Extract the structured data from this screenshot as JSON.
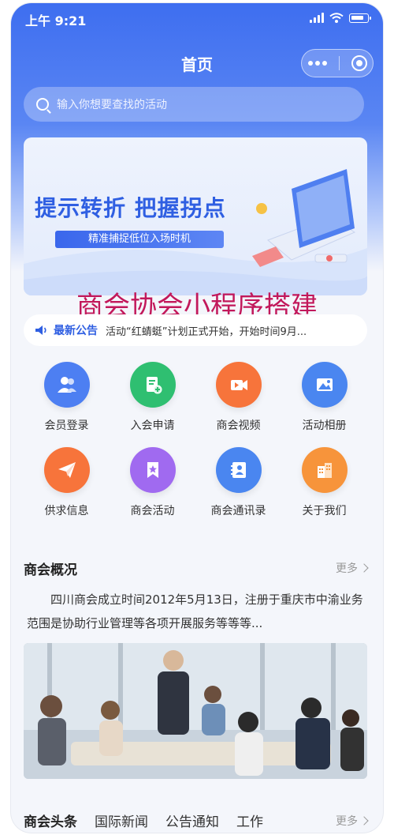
{
  "status_bar": {
    "time": "上午 9:21"
  },
  "nav": {
    "title": "首页"
  },
  "search": {
    "placeholder": "输入你想要查找的活动"
  },
  "banner": {
    "title": "提示转折 把握拐点",
    "subtitle": "精准捕捉低位入场时机"
  },
  "overlay_title": "商会协会小程序搭建",
  "notice": {
    "label": "最新公告",
    "text": "活动“红蜻蜓”计划正式开始，开始时间9月..."
  },
  "grid": [
    {
      "label": "会员登录",
      "icon": "members-icon",
      "color": "#4d7ff2"
    },
    {
      "label": "入会申请",
      "icon": "application-icon",
      "color": "#2fbf71"
    },
    {
      "label": "商会视频",
      "icon": "video-icon",
      "color": "#f7743b"
    },
    {
      "label": "活动相册",
      "icon": "album-icon",
      "color": "#4a86f0"
    },
    {
      "label": "供求信息",
      "icon": "paper-plane-icon",
      "color": "#f7743b"
    },
    {
      "label": "商会活动",
      "icon": "bookmark-star-icon",
      "color": "#a06af0"
    },
    {
      "label": "商会通讯录",
      "icon": "contacts-icon",
      "color": "#4a86f0"
    },
    {
      "label": "关于我们",
      "icon": "building-icon",
      "color": "#f7943b"
    }
  ],
  "overview": {
    "title": "商会概况",
    "more": "更多",
    "text": "四川商会成立时间2012年5月13日，注册于重庆市中渝业务范围是协助行业管理等各项开展服务等等等..."
  },
  "bottom_tabs": {
    "items": [
      "商会头条",
      "国际新闻",
      "公告通知",
      "工作"
    ],
    "more": "更多"
  },
  "colors": {
    "primary": "#3e6ef0",
    "overlay": "#c2185b"
  }
}
